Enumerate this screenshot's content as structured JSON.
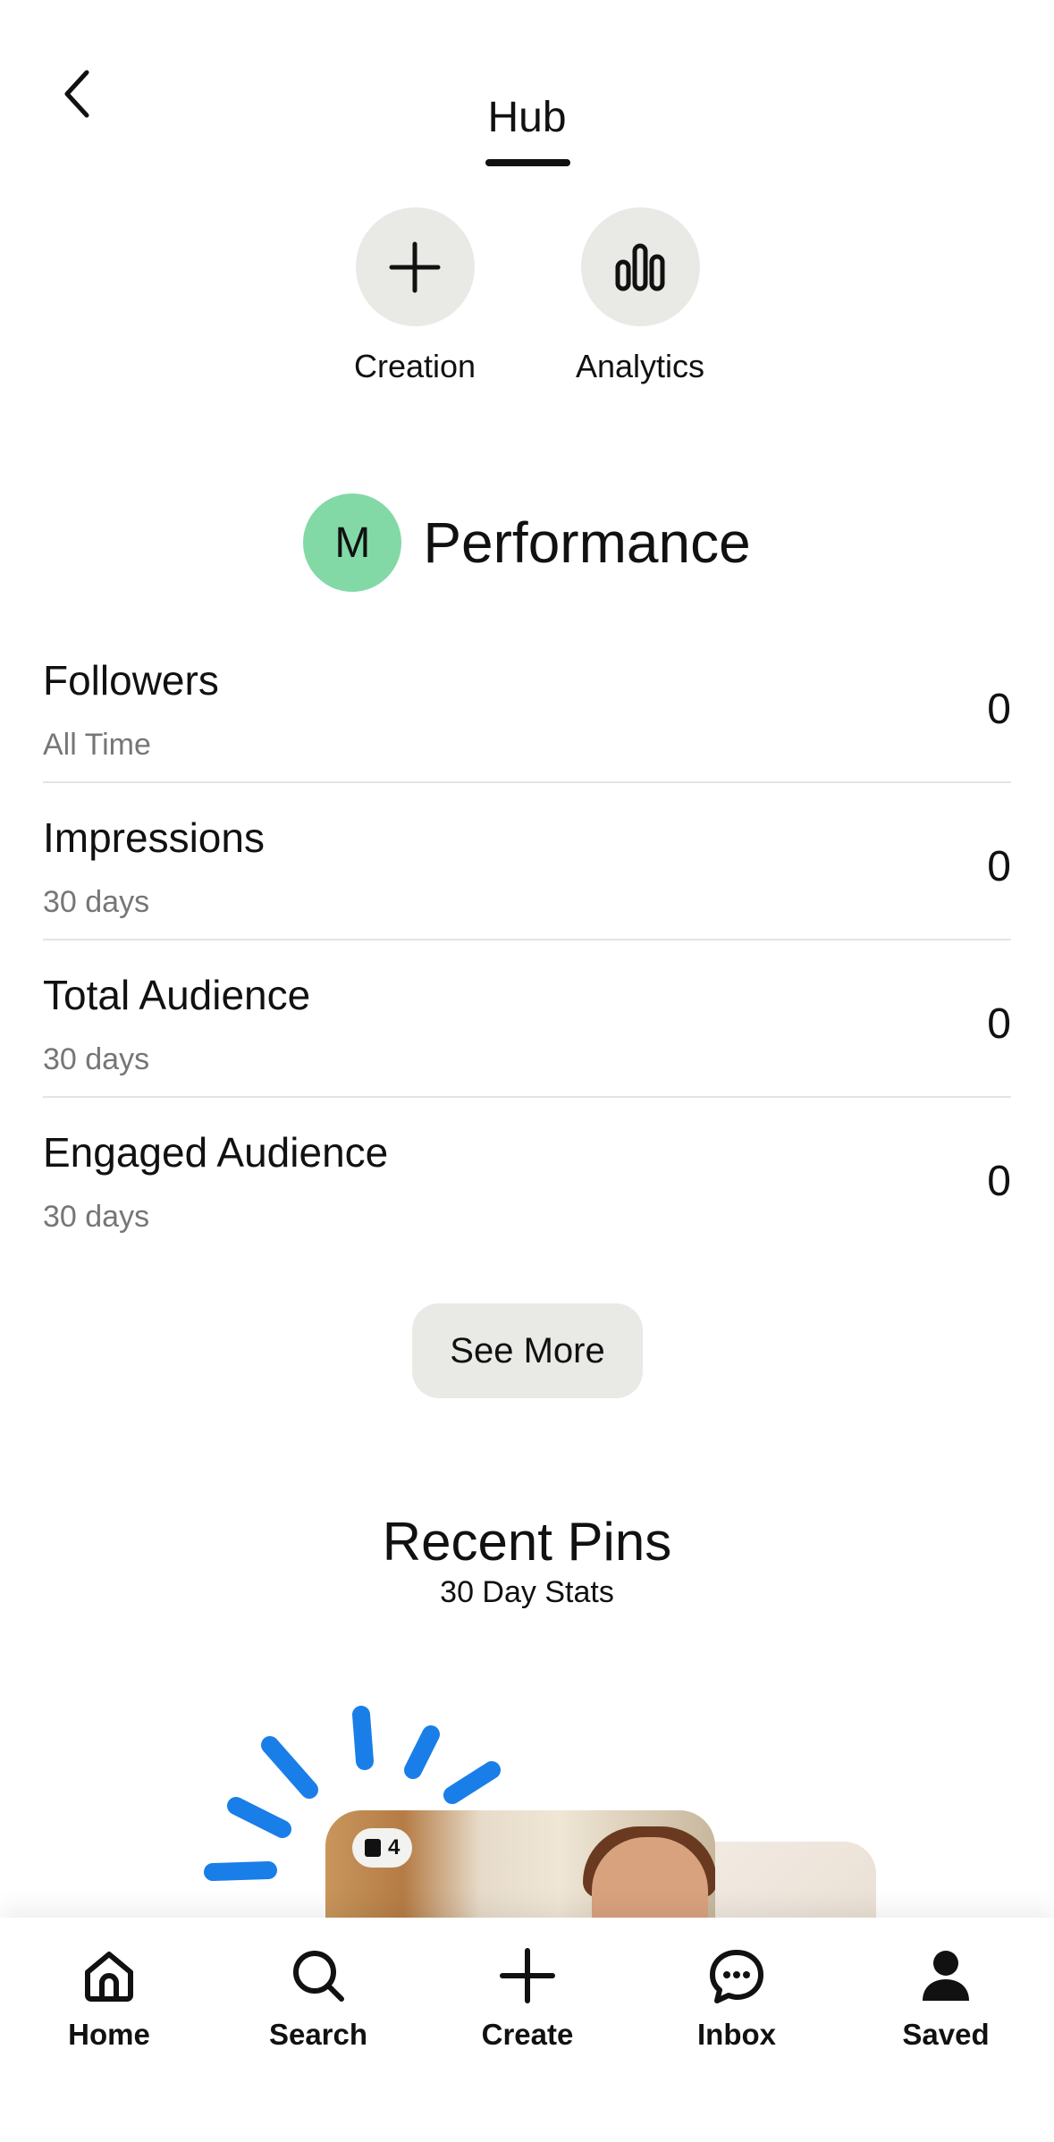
{
  "header": {
    "active_tab": "Hub"
  },
  "quick_actions": [
    {
      "label": "Creation",
      "icon": "plus-icon"
    },
    {
      "label": "Analytics",
      "icon": "bar-chart-icon"
    }
  ],
  "performance": {
    "avatar_initial": "M",
    "avatar_color": "#82d9a6",
    "title": "Performance",
    "stats": [
      {
        "name": "Followers",
        "period": "All Time",
        "value": "0"
      },
      {
        "name": "Impressions",
        "period": "30 days",
        "value": "0"
      },
      {
        "name": "Total Audience",
        "period": "30 days",
        "value": "0"
      },
      {
        "name": "Engaged Audience",
        "period": "30 days",
        "value": "0"
      }
    ],
    "see_more_label": "See More"
  },
  "recent_pins": {
    "title": "Recent Pins",
    "subtitle": "30 Day Stats",
    "badge_count": "4",
    "accent_color": "#1a7ee8"
  },
  "bottom_nav": {
    "items": [
      {
        "label": "Home",
        "icon": "home-icon"
      },
      {
        "label": "Search",
        "icon": "search-icon"
      },
      {
        "label": "Create",
        "icon": "plus-icon"
      },
      {
        "label": "Inbox",
        "icon": "chat-bubble-icon"
      },
      {
        "label": "Saved",
        "icon": "person-icon"
      }
    ]
  }
}
